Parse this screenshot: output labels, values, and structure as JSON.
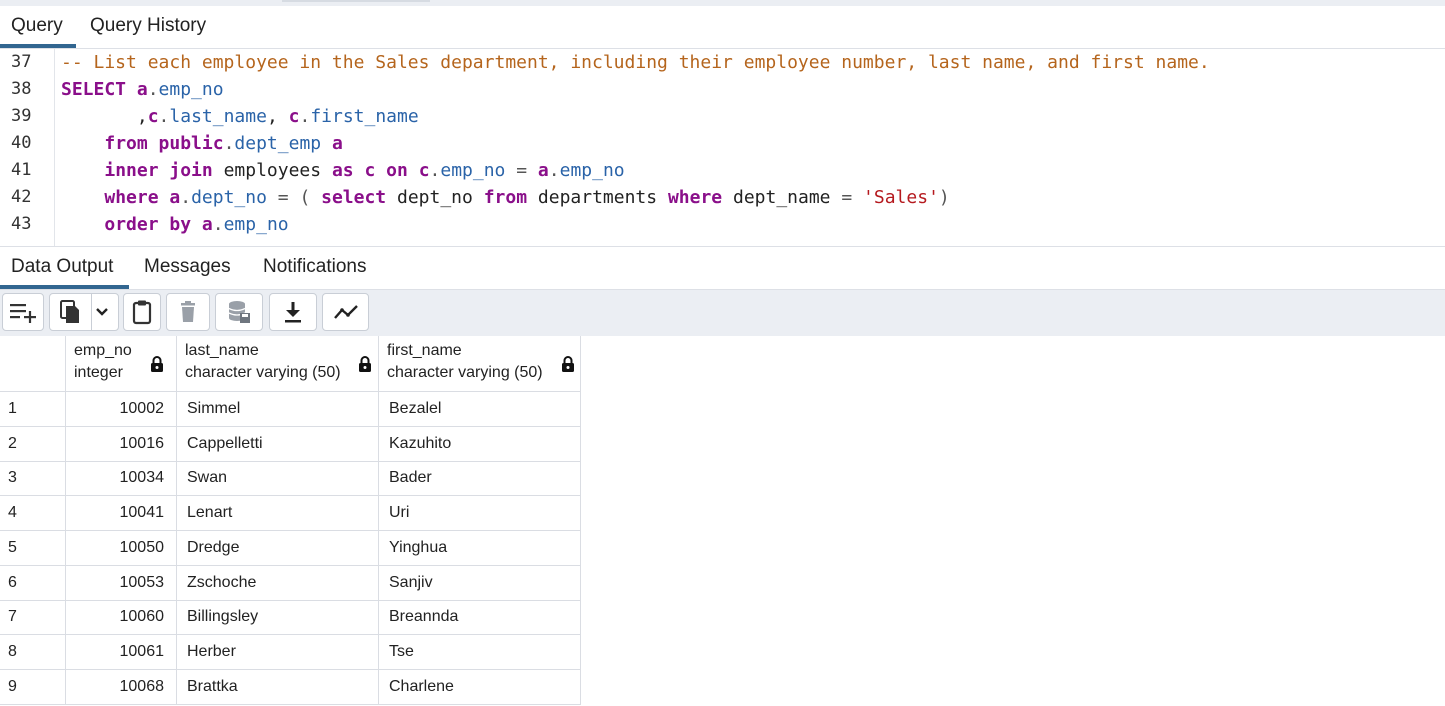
{
  "query_tabs": [
    "Query",
    "Query History"
  ],
  "editor": {
    "line_numbers": [
      "37",
      "38",
      "39",
      "40",
      "41",
      "42",
      "43"
    ],
    "comment": "-- List each employee in the Sales department, including their employee number, last name, and first name."
  },
  "output_tabs": [
    "Data Output",
    "Messages",
    "Notifications"
  ],
  "toolbar_icons": [
    "add-row-icon",
    "copy-icon",
    "chevron-down-icon",
    "paste-icon",
    "delete-icon",
    "save-data-icon",
    "download-icon",
    "graph-icon"
  ],
  "columns": [
    {
      "name": "emp_no",
      "type": "integer"
    },
    {
      "name": "last_name",
      "type": "character varying (50)"
    },
    {
      "name": "first_name",
      "type": "character varying (50)"
    }
  ],
  "rows": [
    {
      "n": "1",
      "emp_no": "10002",
      "last_name": "Simmel",
      "first_name": "Bezalel"
    },
    {
      "n": "2",
      "emp_no": "10016",
      "last_name": "Cappelletti",
      "first_name": "Kazuhito"
    },
    {
      "n": "3",
      "emp_no": "10034",
      "last_name": "Swan",
      "first_name": "Bader"
    },
    {
      "n": "4",
      "emp_no": "10041",
      "last_name": "Lenart",
      "first_name": "Uri"
    },
    {
      "n": "5",
      "emp_no": "10050",
      "last_name": "Dredge",
      "first_name": "Yinghua"
    },
    {
      "n": "6",
      "emp_no": "10053",
      "last_name": "Zschoche",
      "first_name": "Sanjiv"
    },
    {
      "n": "7",
      "emp_no": "10060",
      "last_name": "Billingsley",
      "first_name": "Breannda"
    },
    {
      "n": "8",
      "emp_no": "10061",
      "last_name": "Herber",
      "first_name": "Tse"
    },
    {
      "n": "9",
      "emp_no": "10068",
      "last_name": "Brattka",
      "first_name": "Charlene"
    }
  ],
  "colors": {
    "accent": "#326690",
    "keyword": "#8a0f8a",
    "comment": "#b5651d",
    "field": "#2a63a8",
    "string": "#b5191e"
  }
}
